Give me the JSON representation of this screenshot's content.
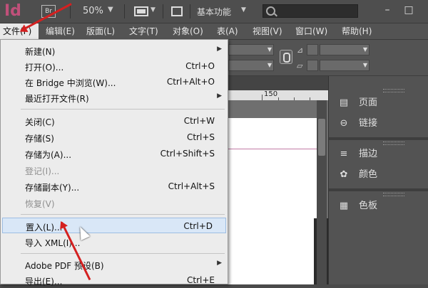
{
  "appbar": {
    "logo": "Id",
    "bridge_label": "Br",
    "zoom": "50%",
    "workspace": "基本功能",
    "search_placeholder": "",
    "minimize": "–",
    "restore": "□"
  },
  "menubar": {
    "items": [
      "文件(F)",
      "编辑(E)",
      "版面(L)",
      "文字(T)",
      "对象(O)",
      "表(A)",
      "视图(V)",
      "窗口(W)",
      "帮助(H)"
    ]
  },
  "ruler": {
    "mark": "150"
  },
  "file_menu": {
    "items": [
      {
        "label": "新建(N)",
        "shortcut": "",
        "submenu": true
      },
      {
        "label": "打开(O)...",
        "shortcut": "Ctrl+O"
      },
      {
        "label": "在 Bridge 中浏览(W)...",
        "shortcut": "Ctrl+Alt+O"
      },
      {
        "label": "最近打开文件(R)",
        "shortcut": "",
        "submenu": true
      },
      {
        "label": "关闭(C)",
        "shortcut": "Ctrl+W"
      },
      {
        "label": "存储(S)",
        "shortcut": "Ctrl+S"
      },
      {
        "label": "存储为(A)...",
        "shortcut": "Ctrl+Shift+S"
      },
      {
        "label": "登记(I)...",
        "shortcut": "",
        "disabled": true
      },
      {
        "label": "存储副本(Y)...",
        "shortcut": "Ctrl+Alt+S"
      },
      {
        "label": "恢复(V)",
        "shortcut": "",
        "disabled": true
      },
      {
        "label": "置入(L)...",
        "shortcut": "Ctrl+D",
        "highlighted": true
      },
      {
        "label": "导入 XML(I)...",
        "shortcut": ""
      },
      {
        "label": "Adobe PDF 预设(B)",
        "shortcut": "",
        "submenu": true
      },
      {
        "label": "导出(E)...",
        "shortcut": "Ctrl+E"
      }
    ]
  },
  "right_panel": {
    "items": [
      {
        "label": "页面",
        "icon": "pages-icon"
      },
      {
        "label": "链接",
        "icon": "links-icon"
      },
      {
        "label": "描边",
        "icon": "stroke-icon"
      },
      {
        "label": "颜色",
        "icon": "color-icon"
      },
      {
        "label": "色板",
        "icon": "swatches-icon"
      }
    ]
  },
  "colors": {
    "accent_logo": "#c0507a",
    "annotation_arrow": "#d42020",
    "menu_highlight": "#d9e7f7"
  }
}
